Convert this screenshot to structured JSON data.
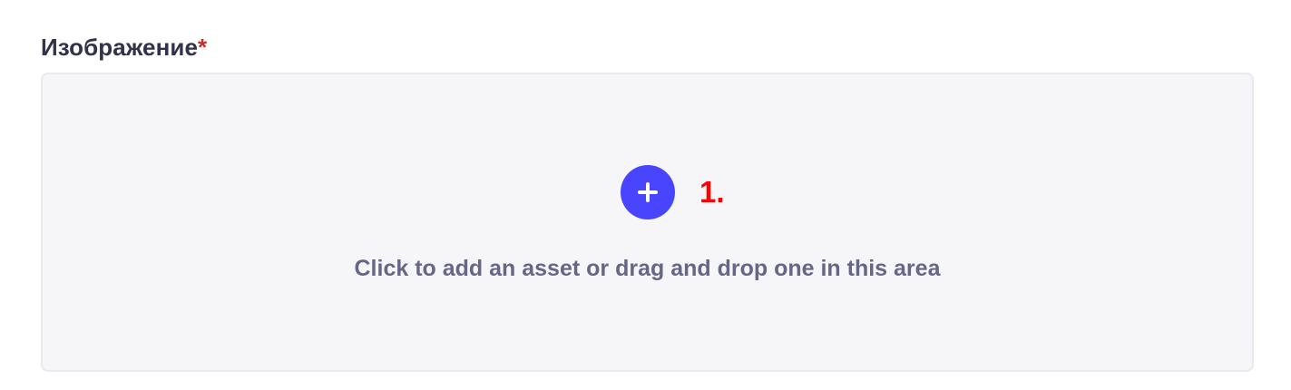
{
  "field": {
    "label": "Изображение",
    "required_marker": "*"
  },
  "dropzone": {
    "add_icon": "plus-icon",
    "hint": "Click to add an asset or drag and drop one in this area"
  },
  "annotation": {
    "number": "1."
  },
  "colors": {
    "accent": "#4945ff",
    "required": "#d02b20",
    "annotation": "#ff0000",
    "dropzone_bg": "#f6f6f9",
    "hint_text": "#666687"
  }
}
